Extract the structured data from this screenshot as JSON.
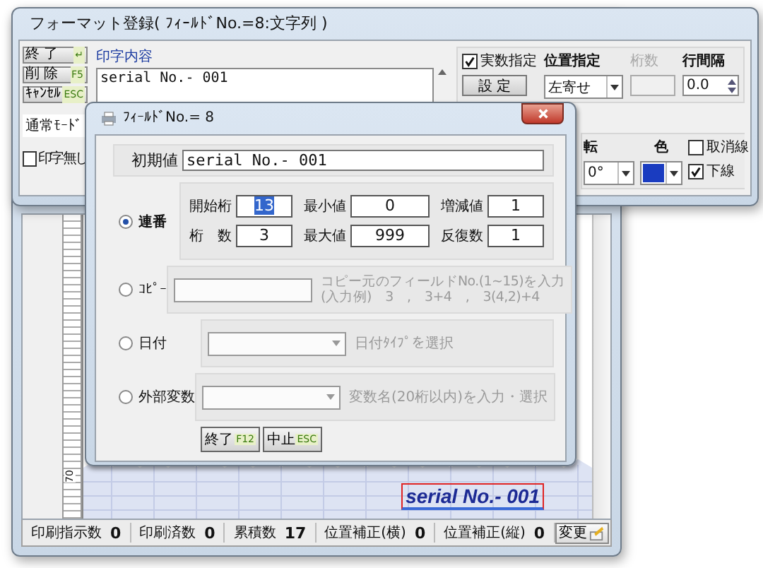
{
  "editor_window": {
    "ruler_label": "70",
    "canvas_text": "serial No.- 001",
    "status_bar": [
      {
        "label": "印刷指示数",
        "value": "0"
      },
      {
        "label": "印刷済数",
        "value": "0"
      },
      {
        "label": "累積数",
        "value": "17"
      },
      {
        "label": "位置補正(横)",
        "value": "0"
      },
      {
        "label": "位置補正(縦)",
        "value": "0"
      }
    ],
    "change_button": "変更"
  },
  "format_window": {
    "title": "フォーマット登録( ﾌｨｰﾙﾄﾞNo.=8:文字列 )",
    "buttons": [
      {
        "label": "終 了",
        "key": "↵"
      },
      {
        "label": "削 除",
        "key": "F5"
      },
      {
        "label": "ｷｬﾝｾﾙ",
        "key": "ESC"
      }
    ],
    "mode_select": "通常ﾓｰﾄﾞ",
    "no_print": {
      "label": "印字無し",
      "checked": false
    },
    "content_label": "印字内容",
    "content": "serial No.- 001",
    "real_number": {
      "label": "実数指定",
      "checked": true
    },
    "set_button": "設 定",
    "position": {
      "label": "位置指定",
      "value": "左寄せ"
    },
    "digits": {
      "label": "桁数",
      "disabled": true
    },
    "line_spacing": {
      "label": "行間隔",
      "value": "0.0"
    },
    "rotation": {
      "label": "転",
      "value": "0°"
    },
    "color": {
      "label": "色",
      "color": "#1a3cc0"
    },
    "strike": {
      "label": "取消線",
      "checked": false
    },
    "underline": {
      "label": "下線",
      "checked": true
    }
  },
  "dialog": {
    "title": "ﾌｨｰﾙﾄﾞNo.= 8",
    "initial_label": "初期値",
    "initial_value": "serial No.- 001",
    "options": [
      {
        "kind": "sequence",
        "label": "連番",
        "selected": true,
        "fields": [
          {
            "label": "開始桁",
            "value": "13",
            "text_selected": true
          },
          {
            "label": "最小値",
            "value": "0",
            "text_selected": false
          },
          {
            "label": "増減値",
            "value": "1",
            "text_selected": false
          },
          {
            "label": "桁　数",
            "value": "3",
            "text_selected": false
          },
          {
            "label": "最大値",
            "value": "999",
            "text_selected": false
          },
          {
            "label": "反復数",
            "value": "1",
            "text_selected": false
          }
        ]
      },
      {
        "kind": "copy",
        "label": "ｺﾋﾟｰ",
        "selected": false,
        "hint": [
          "コピー元のフィールドNo.(1~15)を入力",
          "(入力例)　3　,　3+4　,　3(4,2)+4"
        ]
      },
      {
        "kind": "date",
        "label": "日付",
        "selected": false,
        "hint": [
          "日付ﾀｲﾌﾟを選択"
        ]
      },
      {
        "kind": "external",
        "label": "外部変数",
        "selected": false,
        "hint": [
          "変数名(20桁以内)を入力・選択"
        ]
      }
    ],
    "buttons": [
      {
        "label": "終了",
        "key": "F12"
      },
      {
        "label": "中止",
        "key": "ESC"
      }
    ]
  }
}
